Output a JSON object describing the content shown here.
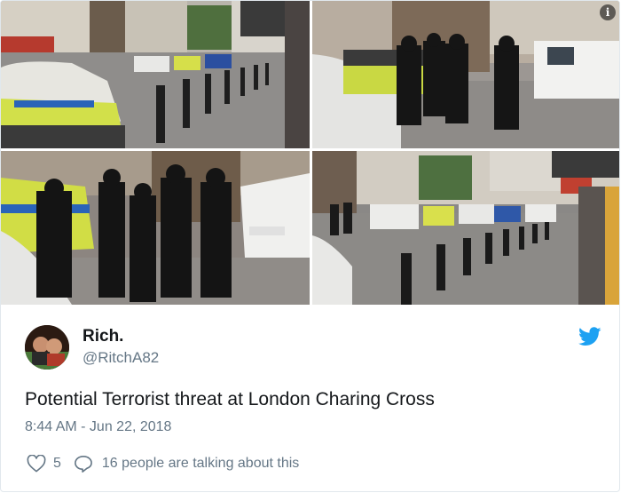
{
  "tweet": {
    "display_name": "Rich.",
    "handle": "@RitchA82",
    "text": "Potential Terrorist threat at London Charing Cross",
    "timestamp": "8:44 AM - Jun 22, 2018",
    "like_count": "5",
    "talking_text": "16 people are talking about this"
  },
  "media": {
    "info_glyph": "i",
    "photos": [
      {
        "name": "photo-police-cars-street"
      },
      {
        "name": "photo-armed-officers-van"
      },
      {
        "name": "photo-armed-officers-closeup"
      },
      {
        "name": "photo-street-police-vehicles"
      }
    ]
  },
  "icons": {
    "twitter": "twitter-bird-icon",
    "like": "heart-icon",
    "reply": "speech-bubble-icon",
    "info": "info-icon"
  },
  "colors": {
    "brand": "#1da1f2",
    "secondary_text": "#657786",
    "primary_text": "#14171a"
  }
}
